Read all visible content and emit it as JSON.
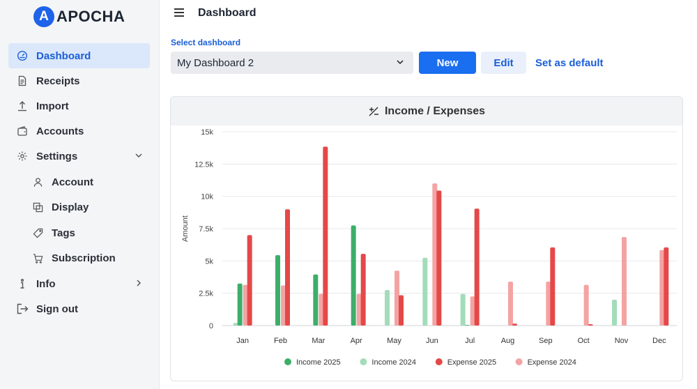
{
  "app": {
    "logo_letter": "A",
    "logo_text": "APOCHA"
  },
  "sidebar": {
    "items": [
      {
        "label": "Dashboard",
        "icon": "gauge-icon",
        "active": true
      },
      {
        "label": "Receipts",
        "icon": "receipt-icon"
      },
      {
        "label": "Import",
        "icon": "upload-icon"
      },
      {
        "label": "Accounts",
        "icon": "wallet-icon"
      },
      {
        "label": "Settings",
        "icon": "gear-icon",
        "expanded": true
      },
      {
        "label": "Account",
        "icon": "user-icon",
        "sub": true
      },
      {
        "label": "Display",
        "icon": "display-icon",
        "sub": true
      },
      {
        "label": "Tags",
        "icon": "tag-icon",
        "sub": true
      },
      {
        "label": "Subscription",
        "icon": "cart-icon",
        "sub": true
      },
      {
        "label": "Info",
        "icon": "info-icon"
      },
      {
        "label": "Sign out",
        "icon": "sign-out-icon"
      }
    ]
  },
  "header": {
    "title": "Dashboard"
  },
  "dashboard_select": {
    "label": "Select dashboard",
    "value": "My Dashboard 2"
  },
  "actions": {
    "new_label": "New",
    "edit_label": "Edit",
    "default_label": "Set as default"
  },
  "card": {
    "title": "Income / Expenses"
  },
  "colors": {
    "accent": "#1a6ef0",
    "income_2025": "#3dae6a",
    "income_2024": "#a3dcb9",
    "expense_2025": "#e54848",
    "expense_2024": "#f4a3a3"
  },
  "chart_data": {
    "type": "bar",
    "title": "Income / Expenses",
    "ylabel": "Amount",
    "xlabel": "",
    "ylim": [
      0,
      15000
    ],
    "yticks": [
      0,
      2500,
      5000,
      7500,
      10000,
      12500,
      15000
    ],
    "ytick_labels": [
      "0",
      "2.5k",
      "5k",
      "7.5k",
      "10k",
      "12.5k",
      "15k"
    ],
    "categories": [
      "Jan",
      "Feb",
      "Mar",
      "Apr",
      "May",
      "Jun",
      "Jul",
      "Aug",
      "Sep",
      "Oct",
      "Nov",
      "Dec"
    ],
    "series": [
      {
        "name": "Income 2024",
        "values": [
          200,
          0,
          0,
          0,
          2750,
          5250,
          2450,
          0,
          0,
          0,
          2000,
          0
        ]
      },
      {
        "name": "Income 2025",
        "values": [
          3250,
          5450,
          3950,
          7750,
          0,
          0,
          50,
          0,
          0,
          0,
          0,
          0
        ]
      },
      {
        "name": "Expense 2024",
        "values": [
          3150,
          3100,
          2450,
          2450,
          4250,
          11000,
          2250,
          3400,
          3400,
          3150,
          6850,
          5850
        ]
      },
      {
        "name": "Expense 2025",
        "values": [
          7000,
          9000,
          13850,
          5550,
          2350,
          10450,
          9050,
          150,
          6050,
          100,
          0,
          6050
        ]
      }
    ],
    "legend": [
      "Income 2025",
      "Income 2024",
      "Expense 2025",
      "Expense 2024"
    ],
    "legend_position": "bottom",
    "grid": true
  }
}
